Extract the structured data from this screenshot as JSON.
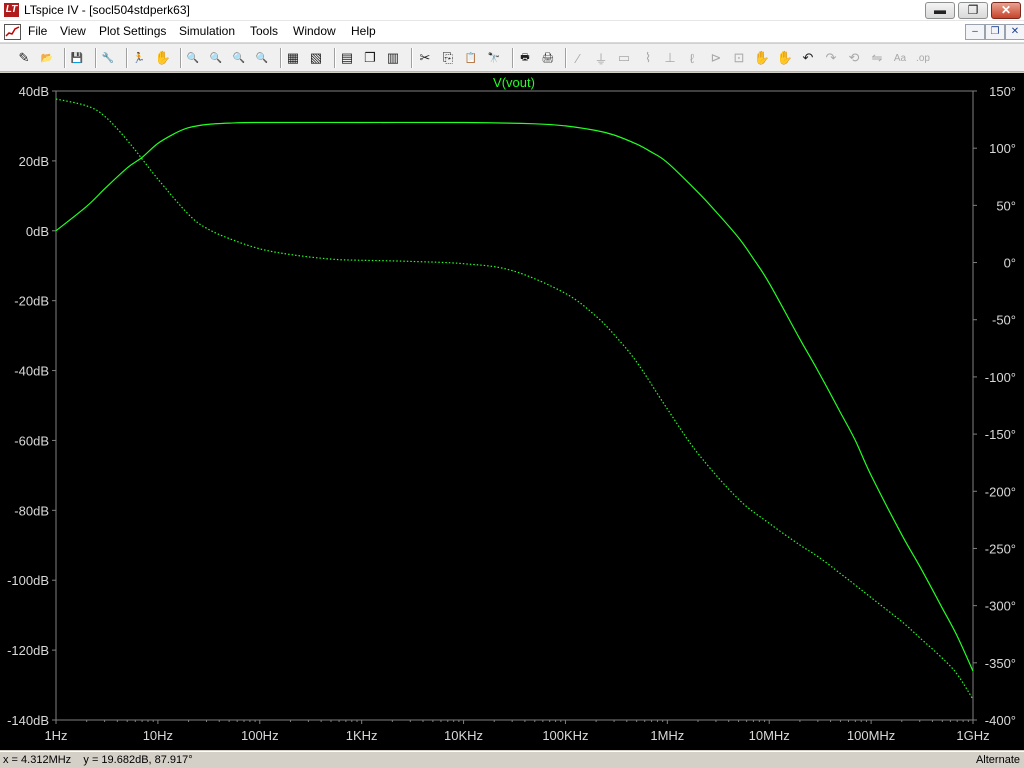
{
  "window": {
    "logo_text": "LT",
    "title": "LTspice IV - [socl504stdperk63]",
    "minimize_glyph": "▬",
    "maximize_glyph": "❐",
    "close_glyph": "✕"
  },
  "menu": {
    "items": [
      {
        "label": "File"
      },
      {
        "label": "View"
      },
      {
        "label": "Plot Settings"
      },
      {
        "label": "Simulation"
      },
      {
        "label": "Tools"
      },
      {
        "label": "Window"
      },
      {
        "label": "Help"
      }
    ],
    "mdi_minimize": "–",
    "mdi_restore": "❐",
    "mdi_close": "✕"
  },
  "toolbar": {
    "icons": [
      {
        "name": "new-schematic-icon",
        "glyph": "✎",
        "enabled": true
      },
      {
        "name": "open-icon",
        "glyph": "📂",
        "enabled": true
      },
      {
        "name": "save-icon",
        "glyph": "💾",
        "enabled": true
      },
      {
        "name": "control-panel-icon",
        "glyph": "🔧",
        "enabled": true
      },
      {
        "name": "run-icon",
        "glyph": "🏃",
        "enabled": true
      },
      {
        "name": "halt-icon",
        "glyph": "✋",
        "enabled": false
      },
      {
        "name": "zoom-in-icon",
        "glyph": "🔍",
        "enabled": true
      },
      {
        "name": "pan-icon",
        "glyph": "🔍",
        "enabled": true
      },
      {
        "name": "zoom-out-icon",
        "glyph": "🔍",
        "enabled": true
      },
      {
        "name": "zoom-fit-icon",
        "glyph": "🔍",
        "enabled": true
      },
      {
        "name": "autorange-icon",
        "glyph": "▦",
        "enabled": true
      },
      {
        "name": "pick-visible-traces-icon",
        "glyph": "▧",
        "enabled": true
      },
      {
        "name": "tile-horizontal-icon",
        "glyph": "▤",
        "enabled": true
      },
      {
        "name": "cascade-icon",
        "glyph": "❐",
        "enabled": true
      },
      {
        "name": "tile-vertical-icon",
        "glyph": "▥",
        "enabled": true
      },
      {
        "name": "cut-icon",
        "glyph": "✂",
        "enabled": true
      },
      {
        "name": "copy-icon",
        "glyph": "⎘",
        "enabled": true
      },
      {
        "name": "paste-icon",
        "glyph": "📋",
        "enabled": true
      },
      {
        "name": "find-icon",
        "glyph": "🔭",
        "enabled": true
      },
      {
        "name": "print-preview-icon",
        "glyph": "🖶",
        "enabled": true
      },
      {
        "name": "print-icon",
        "glyph": "🖨",
        "enabled": true
      },
      {
        "name": "wire-icon",
        "glyph": "∕",
        "enabled": false
      },
      {
        "name": "ground-icon",
        "glyph": "⏚",
        "enabled": false
      },
      {
        "name": "label-net-icon",
        "glyph": "▭",
        "enabled": false
      },
      {
        "name": "resistor-icon",
        "glyph": "⌇",
        "enabled": false
      },
      {
        "name": "capacitor-icon",
        "glyph": "⊥",
        "enabled": false
      },
      {
        "name": "inductor-icon",
        "glyph": "ℓ",
        "enabled": false
      },
      {
        "name": "diode-icon",
        "glyph": "⊳",
        "enabled": false
      },
      {
        "name": "component-icon",
        "glyph": "⊡",
        "enabled": false
      },
      {
        "name": "move-icon",
        "glyph": "✋",
        "enabled": false
      },
      {
        "name": "drag-icon",
        "glyph": "✋",
        "enabled": false
      },
      {
        "name": "undo-icon",
        "glyph": "↶",
        "enabled": true
      },
      {
        "name": "redo-icon",
        "glyph": "↷",
        "enabled": false
      },
      {
        "name": "rotate-icon",
        "glyph": "⟲",
        "enabled": false
      },
      {
        "name": "mirror-icon",
        "glyph": "⇋",
        "enabled": false
      },
      {
        "name": "text-icon",
        "glyph": "Aa",
        "enabled": false
      },
      {
        "name": "spice-directive-icon",
        "glyph": ".op",
        "enabled": false
      }
    ]
  },
  "plot": {
    "background": "#000000",
    "trace_color": "#22ff22",
    "axis_color": "#808080",
    "trace_label": "V(vout)",
    "x_ticks": [
      "1Hz",
      "10Hz",
      "100Hz",
      "1KHz",
      "10KHz",
      "100KHz",
      "1MHz",
      "10MHz",
      "100MHz",
      "1GHz"
    ],
    "y_left_ticks": [
      "40dB",
      "20dB",
      "0dB",
      "-20dB",
      "-40dB",
      "-60dB",
      "-80dB",
      "-100dB",
      "-120dB",
      "-140dB"
    ],
    "y_right_ticks": [
      "150°",
      "100°",
      "50°",
      "0°",
      "-50°",
      "-100°",
      "-150°",
      "-200°",
      "-250°",
      "-300°",
      "-350°",
      "-400°"
    ]
  },
  "chart_data": {
    "type": "line",
    "title": "V(vout)",
    "x_scale": "log",
    "xlim_hz": [
      1,
      1000000000
    ],
    "ylim_left_db": [
      -140,
      40
    ],
    "ylim_right_deg": [
      -400,
      150
    ],
    "grid": false,
    "series": [
      {
        "name": "V(vout)",
        "axis": "left",
        "style": "solid",
        "unit": "dB",
        "x": [
          1,
          2,
          3,
          5,
          7,
          10,
          15,
          20,
          30,
          50,
          100,
          1000,
          10000,
          50000,
          100000,
          200000,
          300000,
          500000,
          700000,
          1000000,
          2000000,
          3000000,
          5000000,
          7000000,
          10000000,
          20000000,
          30000000,
          50000000,
          70000000,
          100000000,
          200000000,
          300000000,
          500000000,
          700000000,
          1000000000
        ],
        "y": [
          0,
          7,
          12,
          18,
          21,
          25,
          28,
          29.5,
          30.4,
          30.8,
          31,
          31,
          31,
          30.6,
          30,
          28.7,
          27.4,
          24.8,
          22.5,
          19.5,
          11,
          5.5,
          -2,
          -8,
          -15,
          -31,
          -40,
          -52,
          -60,
          -70,
          -87,
          -96,
          -108,
          -116,
          -126
        ]
      },
      {
        "name": "V(vout)",
        "axis": "right",
        "style": "dotted",
        "unit": "deg",
        "x": [
          1,
          2,
          3,
          5,
          10,
          20,
          30,
          50,
          100,
          200,
          500,
          1000,
          3000,
          10000,
          30000,
          100000,
          200000,
          300000,
          500000,
          1000000,
          2000000,
          5000000,
          10000000,
          20000000,
          30000000,
          50000000,
          70000000,
          100000000,
          200000000,
          300000000,
          500000000,
          700000000,
          1000000000
        ],
        "y": [
          143,
          137,
          128,
          107,
          73,
          42,
          30,
          21,
          12,
          7,
          3,
          2,
          1,
          -1,
          -7,
          -27,
          -47,
          -63,
          -87,
          -128,
          -167,
          -207,
          -228,
          -247,
          -257,
          -272,
          -282,
          -293,
          -314,
          -328,
          -346,
          -360,
          -382
        ]
      }
    ]
  },
  "status": {
    "readout": "x = 4.312MHz    y = 19.682dB, 87.917°",
    "mode": "Alternate"
  }
}
